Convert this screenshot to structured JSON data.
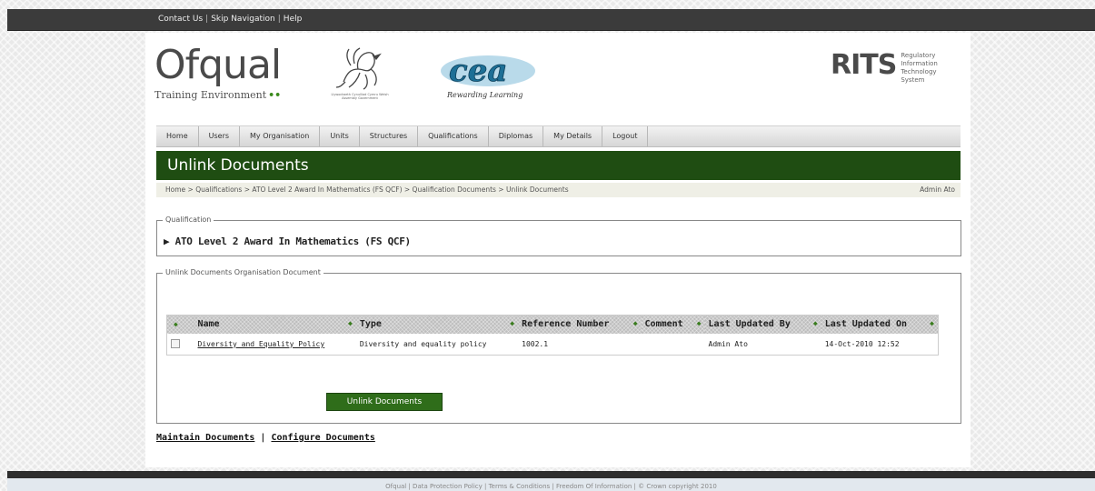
{
  "topbar": {
    "contact": "Contact Us",
    "skip": "Skip Navigation",
    "help": "Help",
    "sep": "|"
  },
  "header": {
    "ofqual_word": "Ofqual",
    "ofqual_sub": "Training Environment",
    "ofqual_dots": "••",
    "welsh_caption": "Llywodraeth Cynulliad Cymru Welsh Assembly Government",
    "cea_tagline": "Rewarding Learning",
    "rits_big": "RITS",
    "rits_lines": [
      "Regulatory",
      "Information",
      "Technology",
      "System"
    ]
  },
  "nav": [
    {
      "label": "Home"
    },
    {
      "label": "Users"
    },
    {
      "label": "My Organisation"
    },
    {
      "label": "Units"
    },
    {
      "label": "Structures"
    },
    {
      "label": "Qualifications"
    },
    {
      "label": "Diplomas"
    },
    {
      "label": "My Details"
    },
    {
      "label": "Logout"
    }
  ],
  "page_title": "Unlink Documents",
  "breadcrumb": {
    "path": "Home > Qualifications > ATO Level 2 Award In Mathematics (FS QCF) > Qualification Documents > Unlink Documents",
    "user": "Admin Ato"
  },
  "qualification": {
    "legend": "Qualification",
    "name": "▶ ATO Level 2 Award In Mathematics (FS QCF)"
  },
  "documents": {
    "legend": "Unlink Documents Organisation Document",
    "columns": [
      "Name",
      "Type",
      "Reference Number",
      "Comment",
      "Last Updated By",
      "Last Updated On"
    ],
    "sort_glyph": "◆",
    "rows": [
      {
        "name": "Diversity and Equality Policy",
        "type": "Diversity and equality policy",
        "reference": "1002.1",
        "comment": "",
        "updated_by": "Admin Ato",
        "updated_on": "14-Oct-2010 12:52"
      }
    ],
    "button": "Unlink Documents"
  },
  "bottom_links": {
    "maintain": "Maintain Documents",
    "sep": "|",
    "configure": "Configure Documents"
  },
  "footer": {
    "text": "Ofqual | Data Protection Policy | Terms & Conditions | Freedom Of Information | © Crown copyright 2010"
  },
  "colors": {
    "title_bar": "#1f4d12",
    "button": "#2f6d1a",
    "sort_arrow": "#3a7d1e",
    "topbar": "#3b3b3b"
  }
}
